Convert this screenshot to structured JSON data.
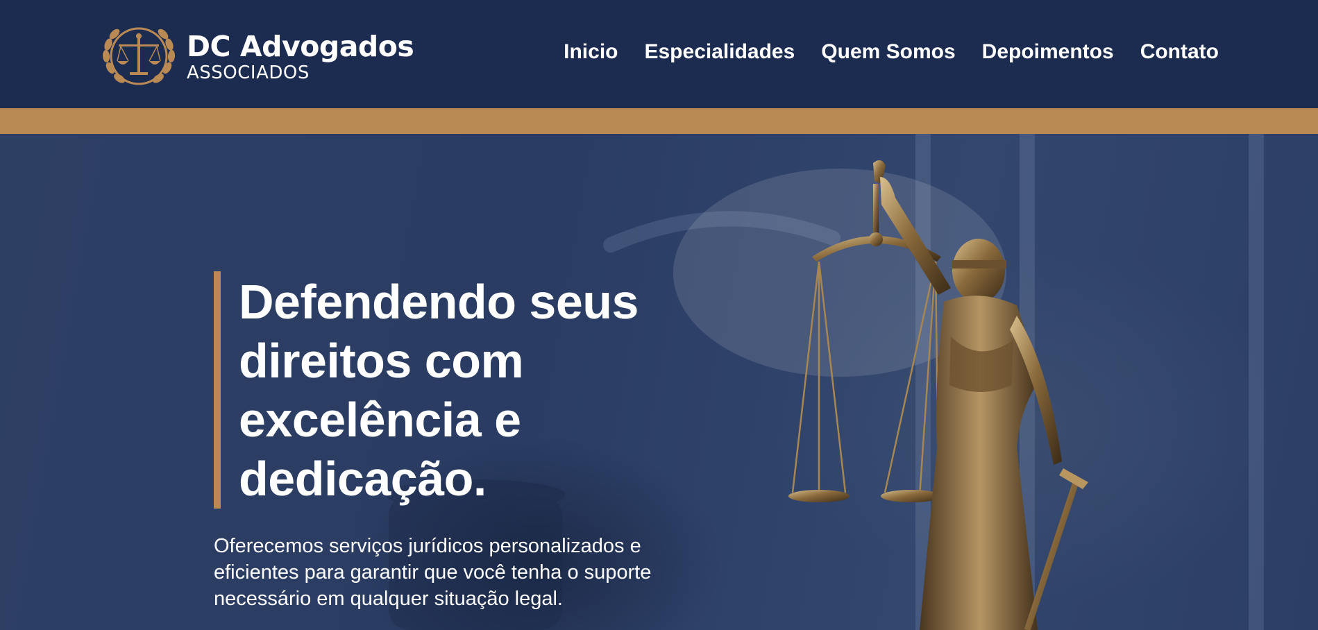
{
  "brand": {
    "name": "DC Advogados",
    "subtitle": "ASSOCIADOS"
  },
  "nav": {
    "items": [
      "Inicio",
      "Especialidades",
      "Quem Somos",
      "Depoimentos",
      "Contato"
    ]
  },
  "hero": {
    "headline": "Defendendo seus direitos com excelência e dedicação.",
    "subtext": "Oferecemos serviços jurídicos personalizados e eficientes para garantir que você tenha o suporte necessário em qualquer situação legal."
  },
  "colors": {
    "navy": "#1c2b50",
    "gold": "#b98a54",
    "text": "#ffffff"
  },
  "icons": {
    "logo": "scales-of-justice-laurel-icon",
    "hero_image": "lady-justice-statue"
  }
}
